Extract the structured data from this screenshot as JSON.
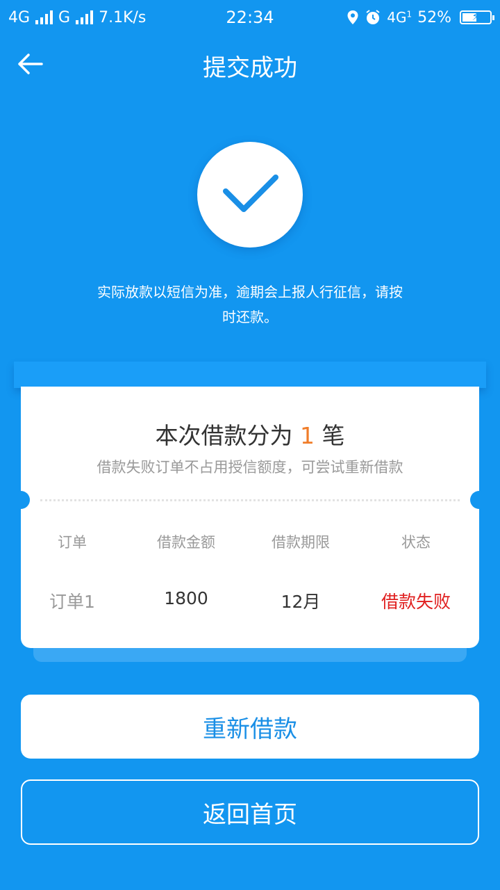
{
  "status_bar": {
    "network1": "4G",
    "network2": "G",
    "speed": "7.1K/s",
    "time": "22:34",
    "network3": "4G",
    "network3_sub": "1",
    "battery": "52%",
    "battery_level": 0.52
  },
  "header": {
    "title": "提交成功"
  },
  "notice": {
    "line1": "实际放款以短信为准，逾期会上报人行征信，请按",
    "line2": "时还款。"
  },
  "card": {
    "title_prefix": "本次借款分为",
    "title_count": "1",
    "title_suffix": "笔",
    "subtitle": "借款失败订单不占用授信额度，可尝试重新借款",
    "columns": [
      "订单",
      "借款金额",
      "借款期限",
      "状态"
    ],
    "rows": [
      {
        "order": "订单1",
        "amount": "1800",
        "term": "12月",
        "status": "借款失败"
      }
    ]
  },
  "buttons": {
    "retry": "重新借款",
    "home": "返回首页"
  },
  "colors": {
    "background": "#1296f0",
    "accent_count": "#f07d2a",
    "status_fail": "#e02020",
    "button_text": "#1a8fe6"
  }
}
